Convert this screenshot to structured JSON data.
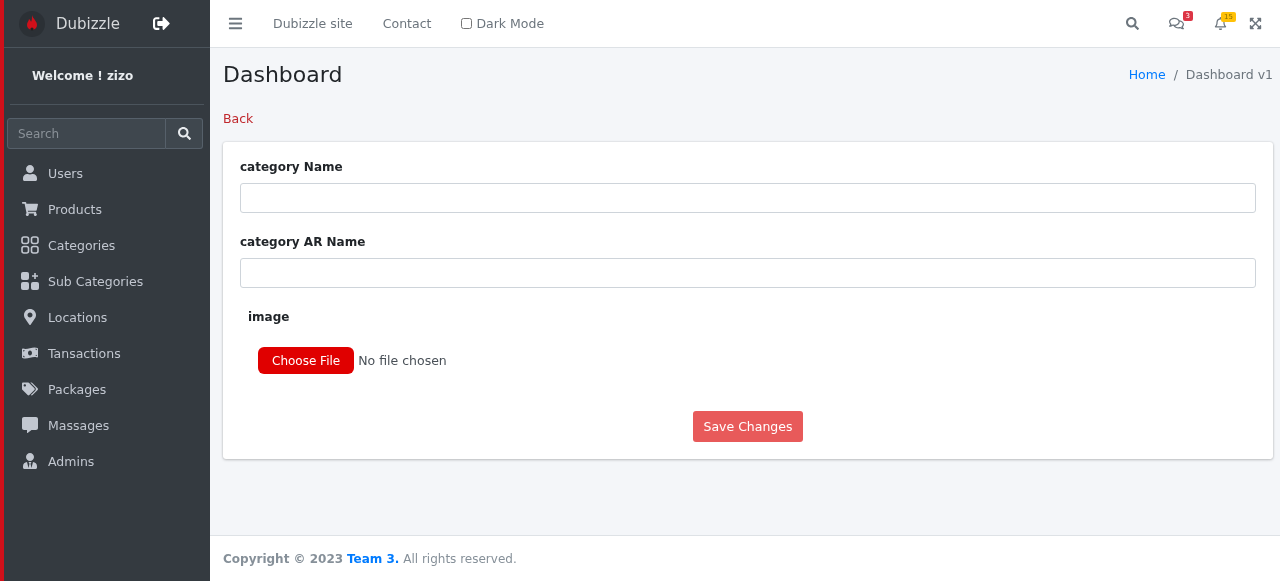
{
  "sidebar": {
    "brand": "Dubizzle",
    "welcome": "Welcome ! zizo",
    "search": {
      "placeholder": "Search"
    },
    "items": [
      {
        "label": "Users"
      },
      {
        "label": "Products"
      },
      {
        "label": "Categories"
      },
      {
        "label": "Sub Categories"
      },
      {
        "label": "Locations"
      },
      {
        "label": "Tansactions"
      },
      {
        "label": "Packages"
      },
      {
        "label": "Massages"
      },
      {
        "label": "Admins"
      }
    ]
  },
  "navbar": {
    "links": [
      "Dubizzle site",
      "Contact"
    ],
    "dark_mode": {
      "label": "Dark Mode",
      "checked": false
    },
    "messages_badge": "3",
    "notifications_badge": "15"
  },
  "page": {
    "title": "Dashboard",
    "breadcrumb": [
      {
        "label": "Home",
        "link": true
      },
      {
        "label": "Dashboard v1",
        "link": false
      }
    ],
    "breadcrumb_separator": "/",
    "back": "Back"
  },
  "form": {
    "fields": [
      {
        "label": "category Name"
      },
      {
        "label": "category AR Name"
      }
    ],
    "image_label": "image",
    "file_button": "Choose File",
    "file_status": "No file chosen",
    "submit": "Save Changes"
  },
  "footer": {
    "prefix": "Copyright © 2023",
    "link": "Team 3.",
    "suffix": "All rights reserved."
  }
}
